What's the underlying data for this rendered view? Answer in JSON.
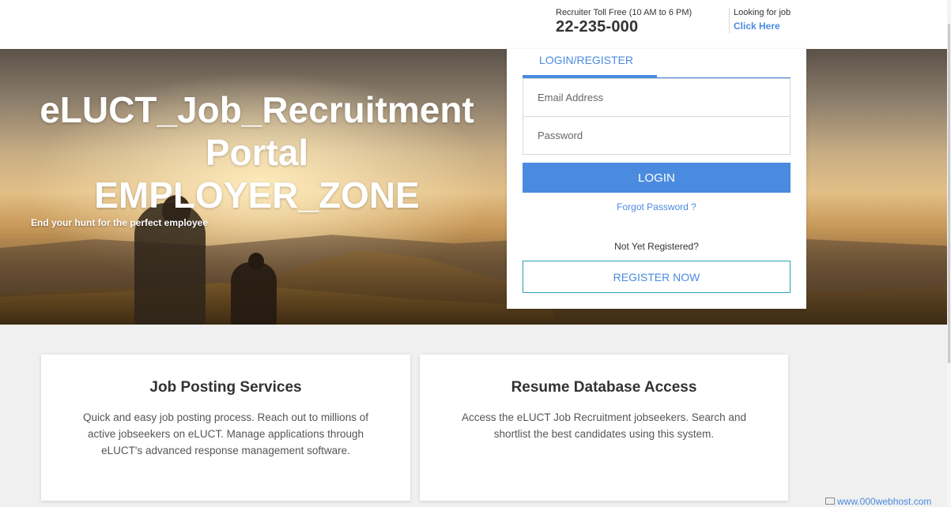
{
  "header": {
    "toll_label": "Recruiter Toll Free (10 AM to 6 PM)",
    "toll_number": "22-235-000",
    "jobseeker_label": "Looking for job",
    "jobseeker_link": "Click Here"
  },
  "hero": {
    "title_line1": "eLUCT_Job_Recruitment",
    "title_line2": "Portal",
    "title_line3": "EMPLOYER_ZONE",
    "subtitle": "End your hunt for the perfect employee"
  },
  "login": {
    "tab_label": "LOGIN/REGISTER",
    "email_placeholder": "Email Address",
    "password_placeholder": "Password",
    "login_button": "LOGIN",
    "forgot_link": "Forgot Password ?",
    "not_registered": "Not Yet Registered?",
    "register_button": "REGISTER NOW"
  },
  "services": [
    {
      "title": "Job Posting Services",
      "description": "Quick and easy job posting process. Reach out to millions of active jobseekers on eLUCT. Manage applications through eLUCT's advanced response management software."
    },
    {
      "title": "Resume Database Access",
      "description": "Access the eLUCT Job Recruitment jobseekers. Search and shortlist the best candidates using this system."
    }
  ],
  "footer": {
    "host_link": "www.000webhost.com"
  },
  "colors": {
    "accent": "#4a8be0",
    "register_border": "#2aa3b0",
    "page_bg": "#f0f0f0"
  }
}
